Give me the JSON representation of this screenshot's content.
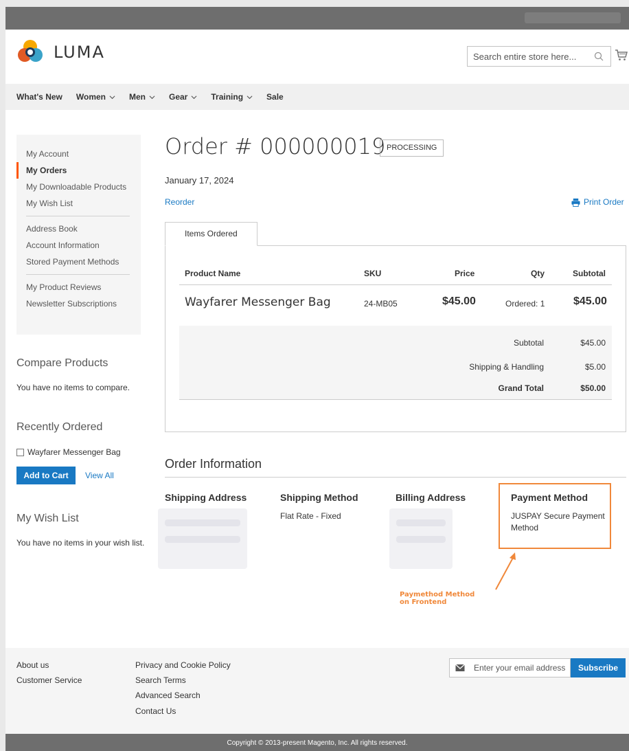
{
  "header": {
    "logo_text": "LUMA",
    "search_placeholder": "Search entire store here...",
    "icons": [
      "luma-logo-icon",
      "search-icon",
      "cart-icon"
    ]
  },
  "nav": {
    "items": [
      {
        "label": "What's New",
        "dropdown": false
      },
      {
        "label": "Women",
        "dropdown": true
      },
      {
        "label": "Men",
        "dropdown": true
      },
      {
        "label": "Gear",
        "dropdown": true
      },
      {
        "label": "Training",
        "dropdown": true
      },
      {
        "label": "Sale",
        "dropdown": false
      }
    ]
  },
  "sidebar": {
    "items": [
      "My Account",
      "My Orders",
      "My Downloadable Products",
      "My Wish List",
      "Address Book",
      "Account Information",
      "Stored Payment Methods",
      "My Product Reviews",
      "Newsletter Subscriptions"
    ],
    "active_index": 1,
    "compare": {
      "title": "Compare Products",
      "text": "You have no items to compare."
    },
    "recently_ordered": {
      "title": "Recently Ordered",
      "item": "Wayfarer Messenger Bag",
      "add_to_cart": "Add to Cart",
      "view_all": "View All"
    },
    "wishlist": {
      "title": "My Wish List",
      "text": "You have no items in your wish list."
    }
  },
  "order": {
    "title": "Order # 000000019",
    "status": "PROCESSING",
    "date": "January 17, 2024",
    "reorder": "Reorder",
    "print": "Print Order",
    "tab": "Items Ordered",
    "columns": {
      "name": "Product Name",
      "sku": "SKU",
      "price": "Price",
      "qty": "Qty",
      "subtotal": "Subtotal"
    },
    "item": {
      "name": "Wayfarer Messenger Bag",
      "sku": "24-MB05",
      "price": "$45.00",
      "qty": "Ordered: 1",
      "subtotal": "$45.00"
    },
    "totals": {
      "subtotal_label": "Subtotal",
      "subtotal": "$45.00",
      "shipping_label": "Shipping & Handling",
      "shipping": "$5.00",
      "grand_label": "Grand Total",
      "grand": "$50.00"
    }
  },
  "info": {
    "title": "Order Information",
    "shipping_address": "Shipping Address",
    "shipping_method": "Shipping Method",
    "shipping_method_value": "Flat Rate - Fixed",
    "billing_address": "Billing Address",
    "payment_method": "Payment Method",
    "payment_method_value": "JUSPAY Secure Payment Method"
  },
  "annotation": {
    "line1": "Paymethod Method",
    "line2": "on Frontend",
    "color": "#f0883a"
  },
  "footer": {
    "col1": [
      "About us",
      "Customer Service"
    ],
    "col2": [
      "Privacy and Cookie Policy",
      "Search Terms",
      "Advanced Search",
      "Contact Us"
    ],
    "newsletter_placeholder": "Enter your email address",
    "subscribe": "Subscribe",
    "copyright": "Copyright © 2013-present Magento, Inc. All rights reserved."
  },
  "colors": {
    "accent": "#1979c3",
    "active_border": "#ff5501",
    "annotation": "#f0883a"
  }
}
